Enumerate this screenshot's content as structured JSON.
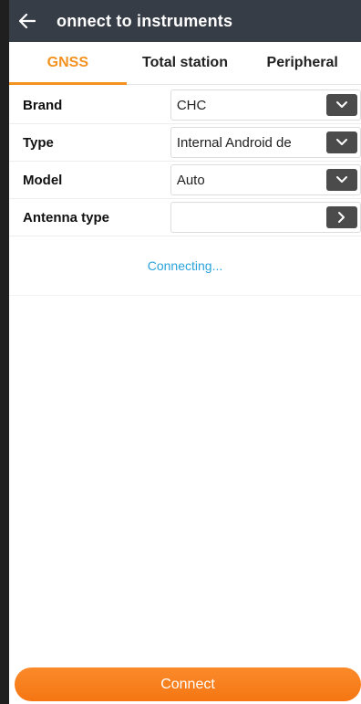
{
  "header": {
    "title": "onnect to instruments"
  },
  "tabs": [
    {
      "label": "GNSS",
      "active": true
    },
    {
      "label": "Total station",
      "active": false
    },
    {
      "label": "Peripheral",
      "active": false
    }
  ],
  "form": {
    "rows": [
      {
        "label": "Brand",
        "value": "CHC",
        "control": "chevron-down-icon"
      },
      {
        "label": "Type",
        "value": "Internal Android de",
        "control": "chevron-down-icon"
      },
      {
        "label": "Model",
        "value": "Auto",
        "control": "chevron-down-icon"
      },
      {
        "label": "Antenna type",
        "value": "",
        "control": "chevron-right-icon"
      }
    ]
  },
  "status": {
    "text": "Connecting..."
  },
  "footer": {
    "connect_label": "Connect"
  },
  "colors": {
    "header_bg": "#373d47",
    "accent": "#f39220",
    "status": "#2aa3dc",
    "control_bg": "#4b4b4b"
  }
}
